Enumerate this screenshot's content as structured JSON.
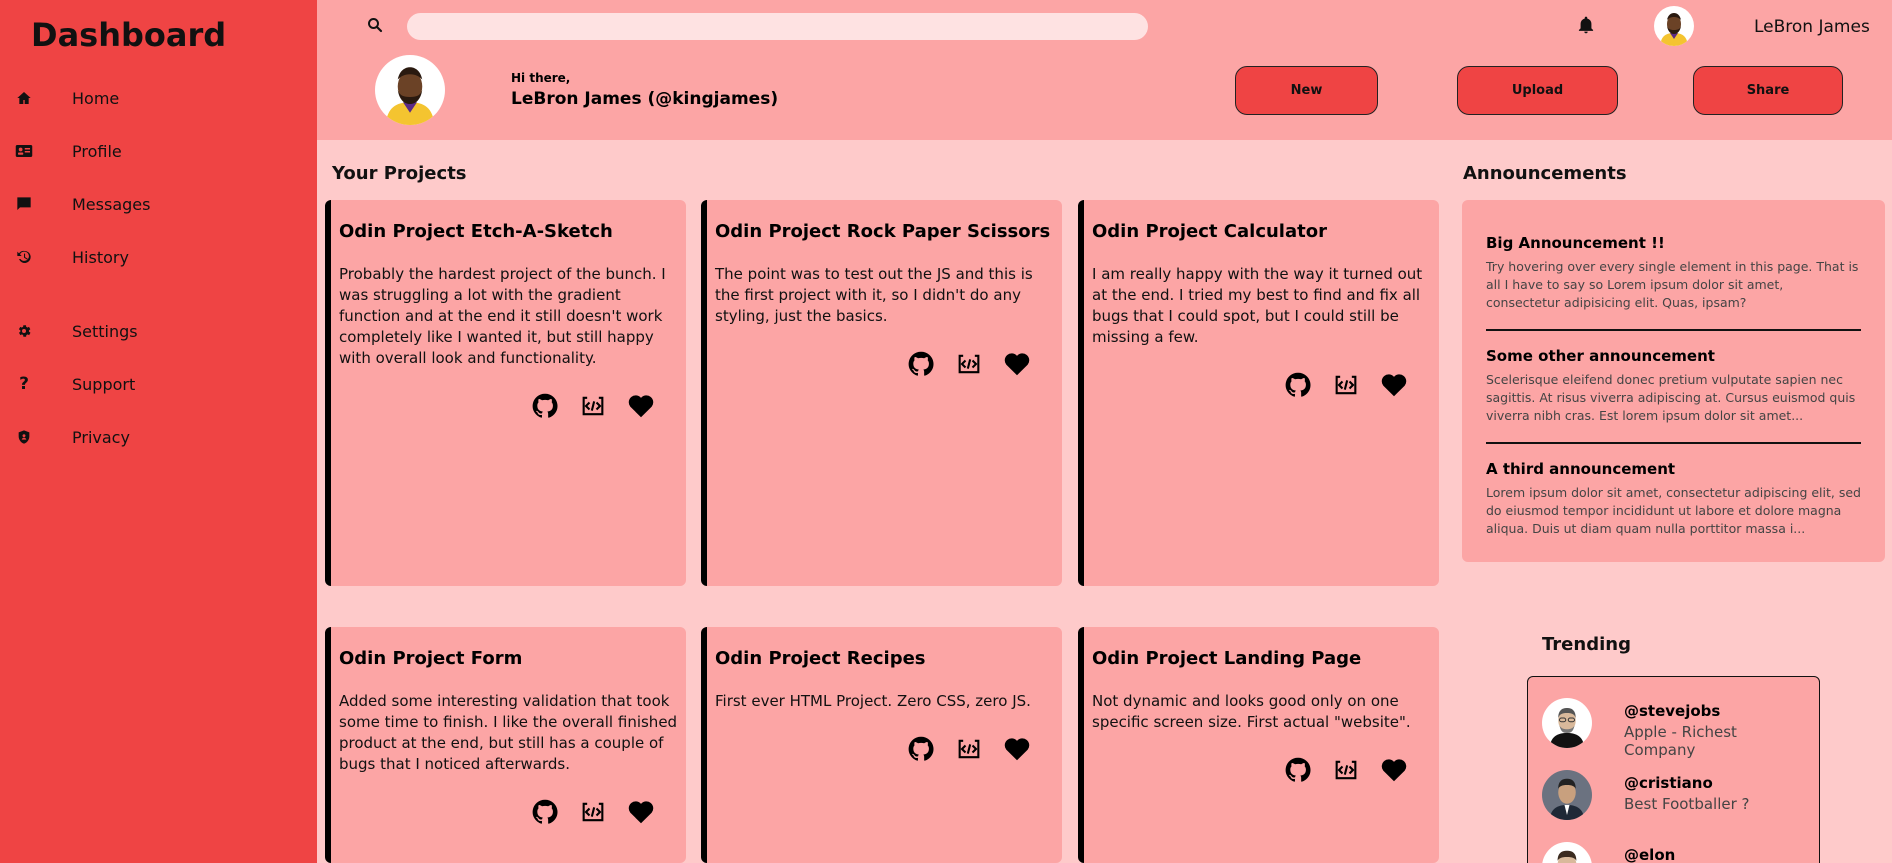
{
  "sidebar": {
    "title": "Dashboard",
    "items": [
      {
        "label": "Home",
        "icon": "home-icon"
      },
      {
        "label": "Profile",
        "icon": "id-card-icon"
      },
      {
        "label": "Messages",
        "icon": "chat-icon"
      },
      {
        "label": "History",
        "icon": "history-icon"
      },
      {
        "label": "Settings",
        "icon": "gear-icon"
      },
      {
        "label": "Support",
        "icon": "question-icon"
      },
      {
        "label": "Privacy",
        "icon": "shield-icon"
      }
    ]
  },
  "header": {
    "search": {
      "value": "",
      "placeholder": ""
    },
    "user_name": "LeBron James",
    "greeting": "Hi there,",
    "full_name": "LeBron James (@kingjames)",
    "buttons": {
      "new": "New",
      "upload": "Upload",
      "share": "Share"
    }
  },
  "projects": {
    "title": "Your Projects",
    "items": [
      {
        "title": "Odin Project Etch-A-Sketch",
        "description": "Probably the hardest project of the bunch. I was struggling a lot with the gradient function and at the end it still doesn't work completely like I wanted it, but still happy with overall look and functionality."
      },
      {
        "title": "Odin Project Rock Paper Scissors",
        "description": "The point was to test out the JS and this is the first project with it, so I didn't do any styling, just the basics."
      },
      {
        "title": "Odin Project Calculator",
        "description": "I am really happy with the way it turned out at the end. I tried my best to find and fix all bugs that I could spot, but I could still be missing a few."
      },
      {
        "title": "Odin Project Form",
        "description": "Added some interesting validation that took some time to finish. I like the overall finished product at the end, but still has a couple of bugs that I noticed afterwards."
      },
      {
        "title": "Odin Project Recipes",
        "description": "First ever HTML Project. Zero CSS, zero JS."
      },
      {
        "title": "Odin Project Landing Page",
        "description": "Not dynamic and looks good only on one specific screen size. First actual \"website\"."
      }
    ]
  },
  "announcements": {
    "title": "Announcements",
    "items": [
      {
        "title": "Big Announcement !!",
        "text": "Try hovering over every single element in this page. That is all I have to say so Lorem ipsum dolor sit amet, consectetur adipisicing elit. Quas, ipsam?"
      },
      {
        "title": "Some other announcement",
        "text": "Scelerisque eleifend donec pretium vulputate sapien nec sagittis. At risus viverra adipiscing at. Cursus euismod quis viverra nibh cras. Est lorem ipsum dolor sit amet..."
      },
      {
        "title": "A third announcement",
        "text": "Lorem ipsum dolor sit amet, consectetur adipiscing elit, sed do eiusmod tempor incididunt ut labore et dolore magna aliqua. Duis ut diam quam nulla porttitor massa i..."
      }
    ]
  },
  "trending": {
    "title": "Trending",
    "items": [
      {
        "handle": "@stevejobs",
        "desc": "Apple - Richest Company"
      },
      {
        "handle": "@cristiano",
        "desc": "Best Footballer ?"
      },
      {
        "handle": "@elon",
        "desc": ""
      }
    ]
  },
  "colors": {
    "sidebar": "#ef4444",
    "header": "#fca5a5",
    "page": "#fecaca",
    "card": "#fca5a5"
  }
}
